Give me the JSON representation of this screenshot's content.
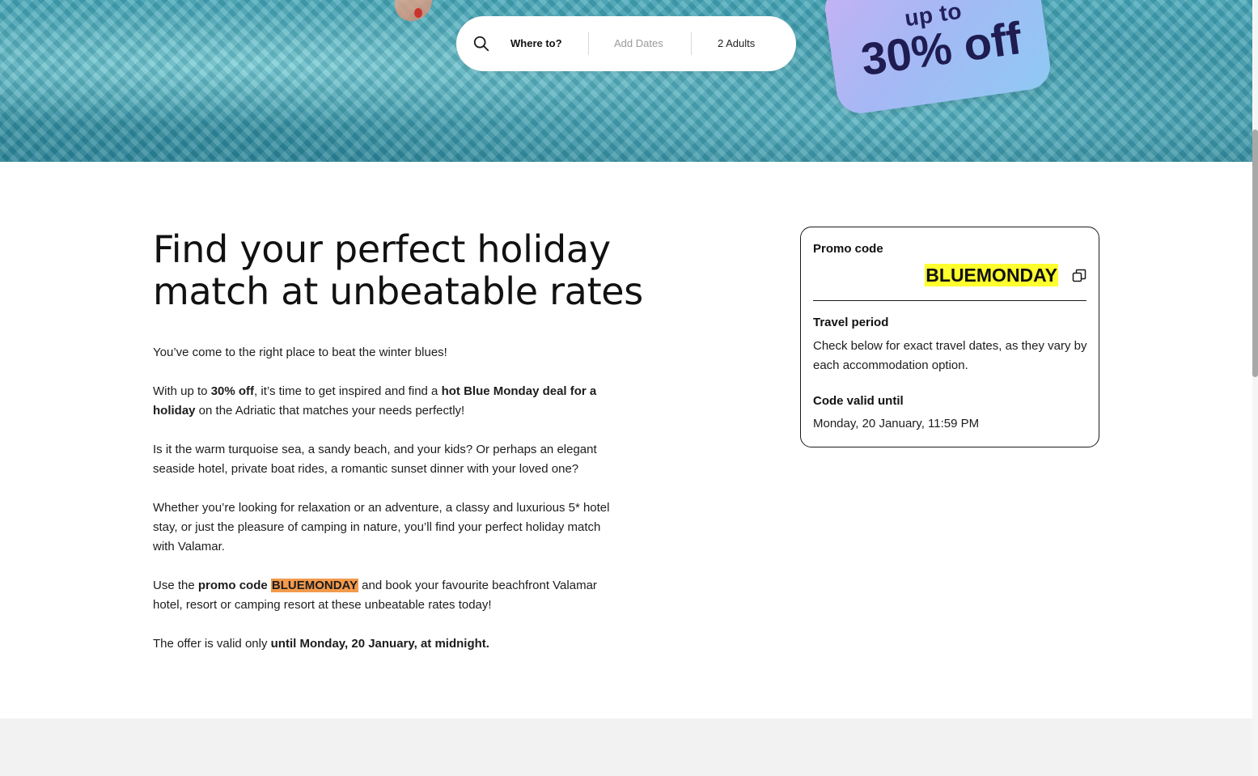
{
  "search": {
    "destination_label": "Where to?",
    "dates_placeholder": "Add Dates",
    "guests_label": "2 Adults"
  },
  "promo_sticker": {
    "line1": "up to",
    "line2": "30% off"
  },
  "main": {
    "headline": "Find your perfect holiday match at unbeatable rates",
    "paragraphs": {
      "p1": "You’ve come to the right place to beat the winter blues!",
      "p2_a": "With up to ",
      "p2_b": "30% off",
      "p2_c": ", it’s time to get inspired and find a ",
      "p2_d": "hot Blue Monday deal for a holiday",
      "p2_e": " on the Adriatic that matches your needs perfectly!",
      "p3": "Is it the warm turquoise sea, a sandy beach, and your kids? Or perhaps an elegant seaside hotel, private boat rides, a romantic sunset dinner with your loved one?",
      "p4": "Whether you’re looking for relaxation or an adventure, a classy and luxurious 5* hotel stay, or just the pleasure of camping in nature, you’ll find your perfect holiday match with Valamar.",
      "p5_a": "Use the ",
      "p5_b": "promo code ",
      "p5_c": "BLUEMONDAY",
      "p5_d": " and book your favourite beachfront Valamar hotel, resort or camping resort at these unbeatable rates today!",
      "p6_a": "The offer is valid only ",
      "p6_b": "until Monday, 20 January, at midnight."
    }
  },
  "promo_card": {
    "promo_label": "Promo code",
    "promo_code": "BLUEMONDAY",
    "travel_period_label": "Travel period",
    "travel_period_text": "Check below for exact travel dates, as they vary by each accommodation option.",
    "valid_until_label": "Code valid until",
    "valid_until_text": "Monday, 20 January, 11:59 PM"
  },
  "colors": {
    "code_highlight": "#ffff2e",
    "inline_code_highlight": "#f39a4c",
    "sticker_gradient_start": "#c5b2f3",
    "sticker_gradient_end": "#8fc9f3",
    "sticker_text": "#1f1c52"
  },
  "icons": {
    "search": "search-icon",
    "copy": "copy-icon"
  }
}
